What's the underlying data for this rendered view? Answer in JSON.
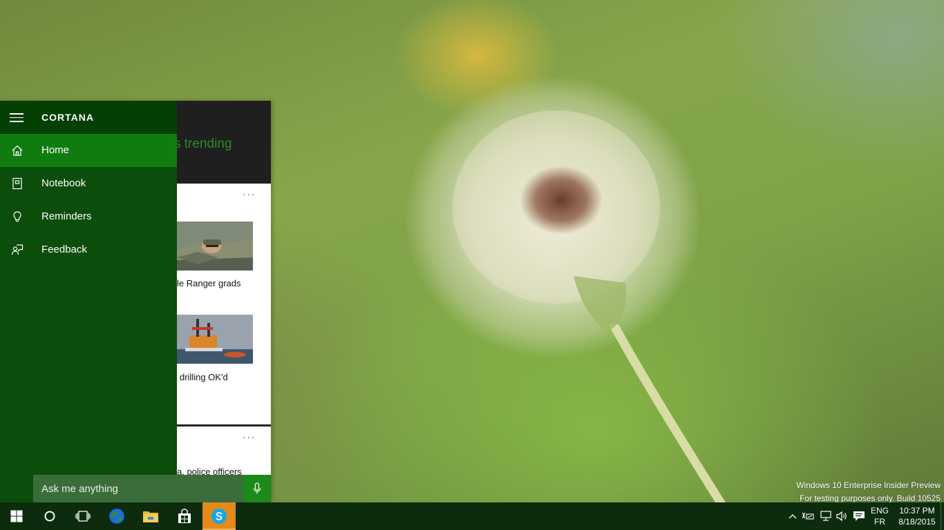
{
  "cortana": {
    "title": "CORTANA",
    "nav_items": [
      {
        "label": "Home",
        "icon": "home-icon"
      },
      {
        "label": "Notebook",
        "icon": "notebook-icon"
      },
      {
        "label": "Reminders",
        "icon": "lightbulb-icon"
      },
      {
        "label": "Feedback",
        "icon": "feedback-icon"
      }
    ],
    "content_header": "s trending",
    "cards": [
      {
        "menu": "...",
        "items": [
          "le Ranger grads",
          "drilling OK'd"
        ]
      },
      {
        "menu": "...",
        "items": [
          "a, police officers"
        ]
      }
    ],
    "search_placeholder": "Ask me anything"
  },
  "watermark": {
    "line1": "Windows 10 Enterprise Insider Preview",
    "line2": "For testing purposes only. Build 10525"
  },
  "taskbar": {
    "apps": [
      "start-icon",
      "cortana-icon",
      "task-view-icon",
      "browser-icon",
      "file-explorer-icon",
      "store-icon",
      "skype-icon"
    ],
    "active_app": "skype-icon",
    "tray": {
      "lang_top": "ENG",
      "lang_bottom": "FR",
      "time": "10:37 PM",
      "date": "8/18/2015"
    }
  },
  "colors": {
    "cortana_nav": "#0b4d0b",
    "cortana_nav_header": "#043f04",
    "active_item": "#107c10",
    "search_box": "#3a6d3a",
    "mic_button": "#1b8a1b",
    "taskbar": "#0d2b0d",
    "skype_highlight": "#e28a1c",
    "trending_text": "#2b8a2b"
  }
}
